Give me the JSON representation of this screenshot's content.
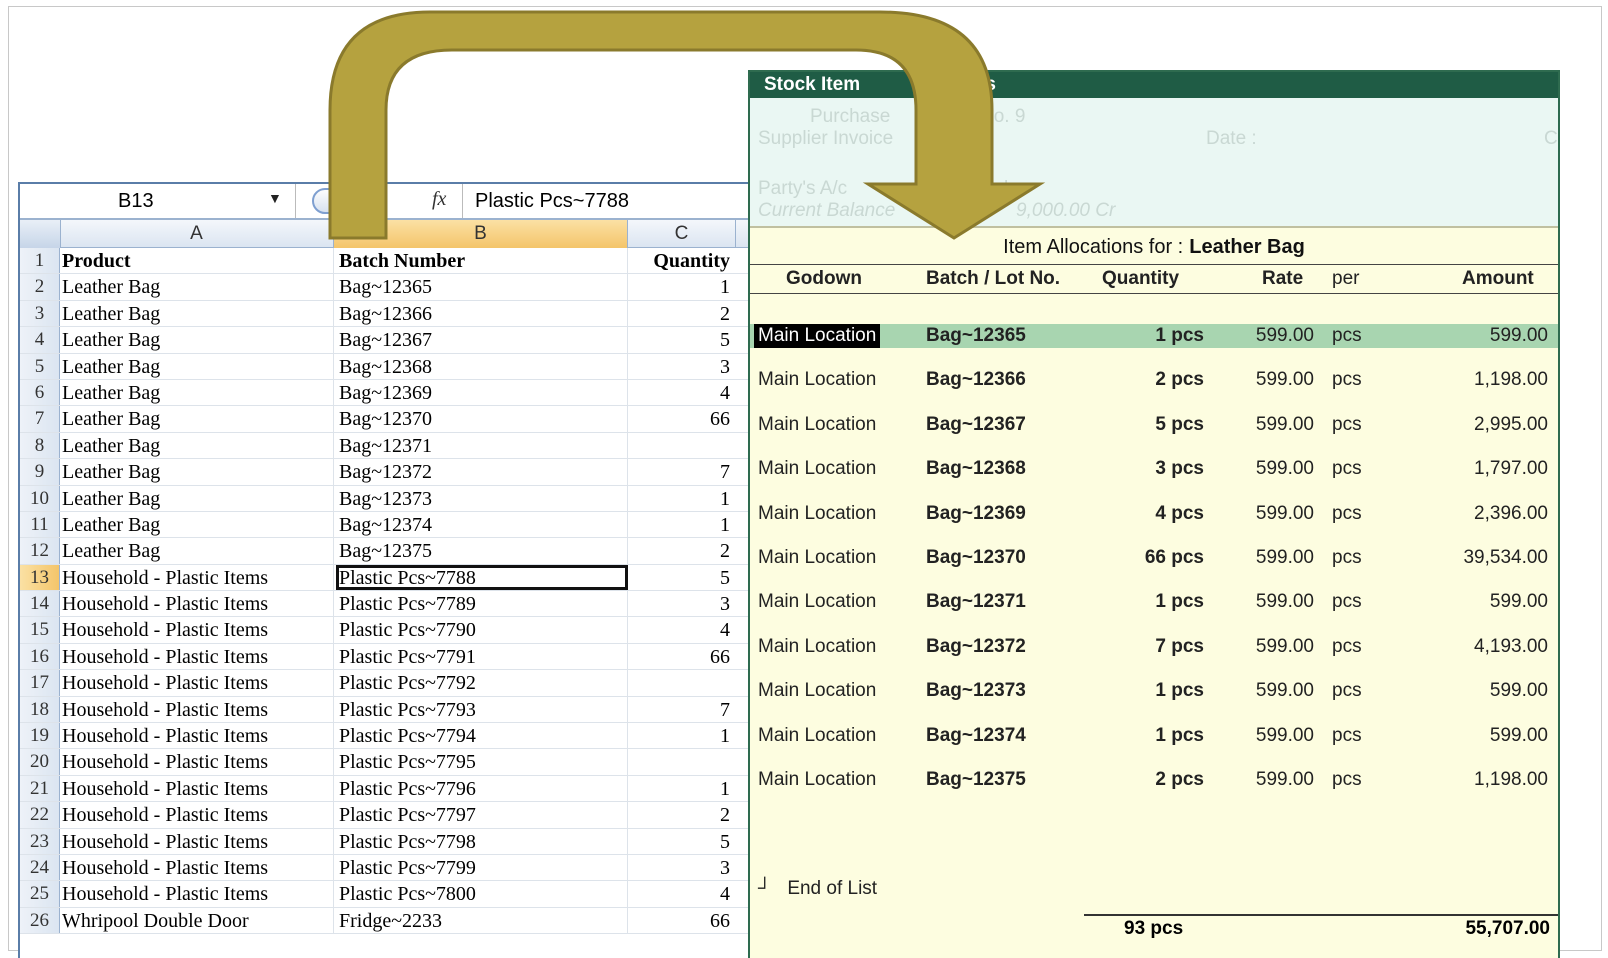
{
  "excel": {
    "name_box": "B13",
    "formula": "Plastic Pcs~7788",
    "fx_label": "fx",
    "columns": [
      "A",
      "B",
      "C"
    ],
    "header": {
      "num": "1",
      "a": "Product",
      "b": "Batch Number",
      "c": "Quantity"
    },
    "rows": [
      {
        "num": "2",
        "a": "Leather Bag",
        "b": "Bag~12365",
        "c": "1"
      },
      {
        "num": "3",
        "a": "Leather Bag",
        "b": "Bag~12366",
        "c": "2"
      },
      {
        "num": "4",
        "a": "Leather Bag",
        "b": "Bag~12367",
        "c": "5"
      },
      {
        "num": "5",
        "a": "Leather Bag",
        "b": "Bag~12368",
        "c": "3"
      },
      {
        "num": "6",
        "a": "Leather Bag",
        "b": "Bag~12369",
        "c": "4"
      },
      {
        "num": "7",
        "a": "Leather Bag",
        "b": "Bag~12370",
        "c": "66"
      },
      {
        "num": "8",
        "a": "Leather Bag",
        "b": "Bag~12371",
        "c": ""
      },
      {
        "num": "9",
        "a": "Leather Bag",
        "b": "Bag~12372",
        "c": "7"
      },
      {
        "num": "10",
        "a": "Leather Bag",
        "b": "Bag~12373",
        "c": "1"
      },
      {
        "num": "11",
        "a": "Leather Bag",
        "b": "Bag~12374",
        "c": "1"
      },
      {
        "num": "12",
        "a": "Leather Bag",
        "b": "Bag~12375",
        "c": "2"
      },
      {
        "num": "13",
        "a": "Household - Plastic Items",
        "b": "Plastic Pcs~7788",
        "c": "5"
      },
      {
        "num": "14",
        "a": "Household - Plastic Items",
        "b": "Plastic Pcs~7789",
        "c": "3"
      },
      {
        "num": "15",
        "a": "Household - Plastic Items",
        "b": "Plastic Pcs~7790",
        "c": "4"
      },
      {
        "num": "16",
        "a": "Household - Plastic Items",
        "b": "Plastic Pcs~7791",
        "c": "66"
      },
      {
        "num": "17",
        "a": "Household - Plastic Items",
        "b": "Plastic Pcs~7792",
        "c": ""
      },
      {
        "num": "18",
        "a": "Household - Plastic Items",
        "b": "Plastic Pcs~7793",
        "c": "7"
      },
      {
        "num": "19",
        "a": "Household - Plastic Items",
        "b": "Plastic Pcs~7794",
        "c": "1"
      },
      {
        "num": "20",
        "a": "Household - Plastic Items",
        "b": "Plastic Pcs~7795",
        "c": ""
      },
      {
        "num": "21",
        "a": "Household - Plastic Items",
        "b": "Plastic Pcs~7796",
        "c": "1"
      },
      {
        "num": "22",
        "a": "Household - Plastic Items",
        "b": "Plastic Pcs~7797",
        "c": "2"
      },
      {
        "num": "23",
        "a": "Household - Plastic Items",
        "b": "Plastic Pcs~7798",
        "c": "5"
      },
      {
        "num": "24",
        "a": "Household - Plastic Items",
        "b": "Plastic Pcs~7799",
        "c": "3"
      },
      {
        "num": "25",
        "a": "Household - Plastic Items",
        "b": "Plastic Pcs~7800",
        "c": "4"
      },
      {
        "num": "26",
        "a": "Whripool Double Door",
        "b": "Fridge~2233",
        "c": "66"
      }
    ]
  },
  "tally": {
    "title_left": "Stock Item",
    "title_right": "ations",
    "bg": {
      "purchase": "Purchase",
      "no": "No.  9",
      "supplier_invoice": "Supplier Invoice",
      "date": "Date  :",
      "c": "C",
      "party": "Party's A/c",
      "h": "h",
      "current_balance": "Current Balance",
      "balance_value": "9,000.00 Cr"
    },
    "heading_label": "Item Allocations for :",
    "heading_item": "Leather Bag",
    "col_godown": "Godown",
    "col_batch": "Batch / Lot No.",
    "col_qty": "Quantity",
    "col_rate": "Rate",
    "col_per": "per",
    "col_amount": "Amount",
    "rows": [
      {
        "godown": "Main Location",
        "batch": "Bag~12365",
        "qty": "1 pcs",
        "rate": "599.00",
        "per": "pcs",
        "amount": "599.00"
      },
      {
        "godown": "Main Location",
        "batch": "Bag~12366",
        "qty": "2 pcs",
        "rate": "599.00",
        "per": "pcs",
        "amount": "1,198.00"
      },
      {
        "godown": "Main Location",
        "batch": "Bag~12367",
        "qty": "5 pcs",
        "rate": "599.00",
        "per": "pcs",
        "amount": "2,995.00"
      },
      {
        "godown": "Main Location",
        "batch": "Bag~12368",
        "qty": "3 pcs",
        "rate": "599.00",
        "per": "pcs",
        "amount": "1,797.00"
      },
      {
        "godown": "Main Location",
        "batch": "Bag~12369",
        "qty": "4 pcs",
        "rate": "599.00",
        "per": "pcs",
        "amount": "2,396.00"
      },
      {
        "godown": "Main Location",
        "batch": "Bag~12370",
        "qty": "66 pcs",
        "rate": "599.00",
        "per": "pcs",
        "amount": "39,534.00"
      },
      {
        "godown": "Main Location",
        "batch": "Bag~12371",
        "qty": "1 pcs",
        "rate": "599.00",
        "per": "pcs",
        "amount": "599.00"
      },
      {
        "godown": "Main Location",
        "batch": "Bag~12372",
        "qty": "7 pcs",
        "rate": "599.00",
        "per": "pcs",
        "amount": "4,193.00"
      },
      {
        "godown": "Main Location",
        "batch": "Bag~12373",
        "qty": "1 pcs",
        "rate": "599.00",
        "per": "pcs",
        "amount": "599.00"
      },
      {
        "godown": "Main Location",
        "batch": "Bag~12374",
        "qty": "1 pcs",
        "rate": "599.00",
        "per": "pcs",
        "amount": "599.00"
      },
      {
        "godown": "Main Location",
        "batch": "Bag~12375",
        "qty": "2 pcs",
        "rate": "599.00",
        "per": "pcs",
        "amount": "1,198.00"
      }
    ],
    "end_marker": "┘",
    "end_of_list": "End of List",
    "total_qty": "93 pcs",
    "total_amount": "55,707.00"
  },
  "colors": {
    "arrow_fill": "#b5a23f",
    "arrow_stroke": "#8a7a2c",
    "tally_title_bg": "#1f5c45",
    "tally_panel_bg": "#fdfde0",
    "highlight_row": "#a8d5b0"
  }
}
